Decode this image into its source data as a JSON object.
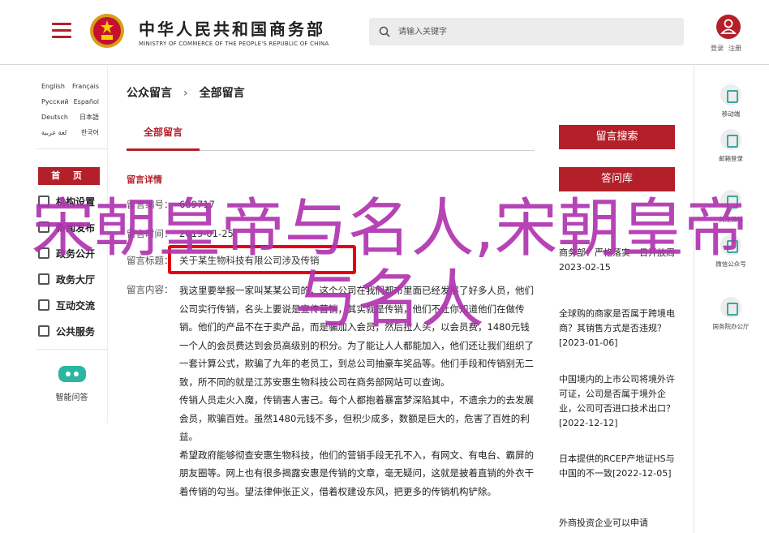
{
  "header": {
    "site_title": "中华人民共和国商务部",
    "site_subtitle": "MINISTRY OF COMMERCE OF THE PEOPLE'S REPUBLIC OF CHINA",
    "search_placeholder": "请输入关键字",
    "login": "登录",
    "register": "注册",
    "accent_color": "#b3202a"
  },
  "leftnav": {
    "languages": [
      [
        "English",
        "Français"
      ],
      [
        "Русский",
        "Español"
      ],
      [
        "Deutsch",
        "日本語"
      ],
      [
        "لغة عربية",
        "한국어"
      ]
    ],
    "home": "首 页",
    "items": [
      "机构设置",
      "新闻发布",
      "政务公开",
      "政务大厅",
      "互动交流",
      "公共服务"
    ],
    "smart_qa": "智能问答"
  },
  "main": {
    "breadcrumb": [
      "公众留言",
      "全部留言"
    ],
    "tab": "全部留言",
    "detail_title": "留言详情",
    "fields": {
      "no_label": "留言编号：",
      "no_value": "689717",
      "time_label": "留言时间：",
      "time_value": "2019-01-25",
      "topic_label": "留言标题：",
      "topic_value": "关于某生物科技有限公司涉及传销",
      "content_label": "留言内容："
    },
    "content": [
      "我这里要举报一家叫某某公司的，这个公司在我们都市里面已经发展了好多人员，他们公司实行传销，名头上要说是宣传营销，其实就是传销，他们不让你知道他们在做传销。他们的产品不在于卖产品，而是骗加入会员，然后拉人头，以会员费，1480元钱一个人的会员费达到会员高级别的积分。为了能让人人都能加入，他们还让我们组织了一套计算公式，欺骗了九年的老员工，到总公司抽豪车奖品等。他们手段和传销别无二致，所不同的就是江苏安惠生物科技公司在商务部网站可以查询。",
      "传销人员走火入魔，传销害人害己。每个人都抱着暴富梦深陷其中，不遗余力的去发展会员，欺骗百姓。虽然1480元钱不多，但积少成多，数额是巨大的，危害了百姓的利益。",
      "希望政府能够彻查安惠生物科技，他们的营销手段无孔不入，有网文、有电台、霸屏的朋友圈等。网上也有很多揭露安惠是传销的文章，毫无疑问，这就是披着直销的外衣干着传销的勾当。望法律伸张正义，借着权建设东风，把更多的传销机构铲除。"
    ]
  },
  "right": {
    "search_button": "留言搜索",
    "faq_button": "答问库",
    "news": [
      {
        "title": "商务部：严格落实一日开放周",
        "date": "2023-02-15"
      },
      {
        "title": "全球购的商家是否属于跨境电商？其销售方式是否违规？",
        "date": "[2023-01-06]"
      },
      {
        "title": "中国境内的上市公司将境外许可证，公司是否属于境外企业，公司可否进口技术出口？",
        "date": "[2022-12-12]"
      },
      {
        "title": "日本提供的RCEP产地证HS与中国的不一致",
        "date": "[2022-12-05]"
      },
      {
        "title": "外商投资企业可以申请",
        "date": ""
      }
    ]
  },
  "rightbar": [
    {
      "icon": "mobile-icon",
      "label": "移动端"
    },
    {
      "icon": "mail-icon",
      "label": "邮箱登录"
    },
    {
      "icon": "weibo-icon",
      "label": "关注微博"
    },
    {
      "icon": "wechat-icon",
      "label": "微信公众号"
    },
    {
      "icon": "at-icon",
      "label": "国务院办公厅"
    }
  ],
  "overlay_text": "宋朝皇帝与名人,宋朝皇帝与名人"
}
